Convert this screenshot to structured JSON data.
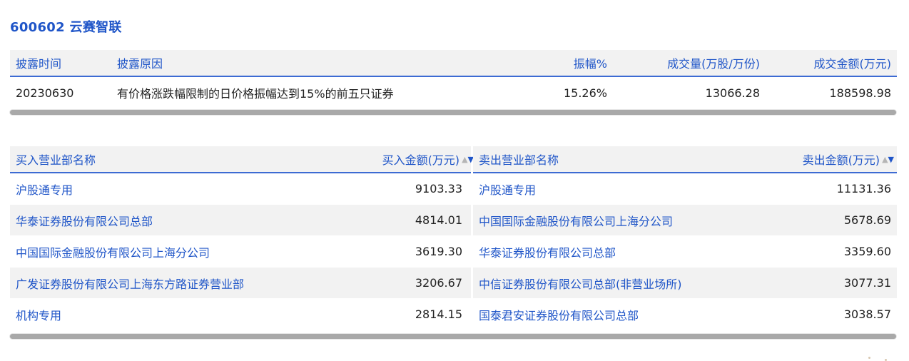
{
  "title": "600602 云赛智联",
  "disclosure": {
    "headers": [
      "披露时间",
      "披露原因",
      "振幅%",
      "成交量(万股/万份)",
      "成交金额(万元)"
    ],
    "row": {
      "date": "20230630",
      "reason": "有价格涨跌幅限制的日价格振幅达到15%的前五只证券",
      "amplitude": "15.26%",
      "volume": "13066.28",
      "amount": "188598.98"
    }
  },
  "buy": {
    "header_name": "买入营业部名称",
    "header_amount": "买入金额(万元)",
    "rows": [
      {
        "name": "沪股通专用",
        "amount": "9103.33"
      },
      {
        "name": "华泰证券股份有限公司总部",
        "amount": "4814.01"
      },
      {
        "name": "中国国际金融股份有限公司上海分公司",
        "amount": "3619.30"
      },
      {
        "name": "广发证券股份有限公司上海东方路证券营业部",
        "amount": "3206.67"
      },
      {
        "name": "机构专用",
        "amount": "2814.15"
      }
    ]
  },
  "sell": {
    "header_name": "卖出营业部名称",
    "header_amount": "卖出金额(万元)",
    "rows": [
      {
        "name": "沪股通专用",
        "amount": "11131.36"
      },
      {
        "name": "中国国际金融股份有限公司上海分公司",
        "amount": "5678.69"
      },
      {
        "name": "华泰证券股份有限公司总部",
        "amount": "3359.60"
      },
      {
        "name": "中信证券股份有限公司总部(非营业场所)",
        "amount": "3077.31"
      },
      {
        "name": "国泰君安证券股份有限公司总部",
        "amount": "3038.57"
      }
    ]
  },
  "sort_icons": {
    "up": "▲",
    "down": "▼"
  }
}
